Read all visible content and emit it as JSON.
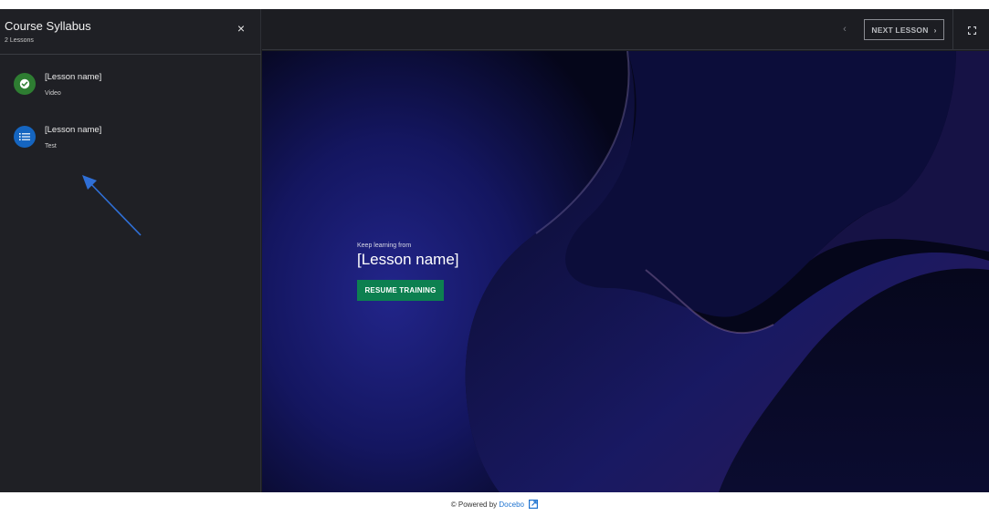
{
  "sidebar": {
    "title": "Course Syllabus",
    "subtitle": "2 Lessons",
    "close_icon": "×",
    "lessons": [
      {
        "name": "[Lesson name]",
        "type": "Video",
        "icon": "check-circle-icon",
        "color": "#2e7d32"
      },
      {
        "name": "[Lesson name]",
        "type": "Test",
        "icon": "list-icon",
        "color": "#1565c0"
      }
    ]
  },
  "topbar": {
    "prev_icon": "‹",
    "next_label": "NEXT LESSON",
    "next_icon": "›"
  },
  "stage": {
    "keep_learning": "Keep learning from",
    "lesson_name": "[Lesson name]",
    "resume_label": "RESUME TRAINING",
    "resume_color": "#0d8050"
  },
  "footer": {
    "powered_prefix": "© Powered by",
    "brand": "Docebo"
  }
}
